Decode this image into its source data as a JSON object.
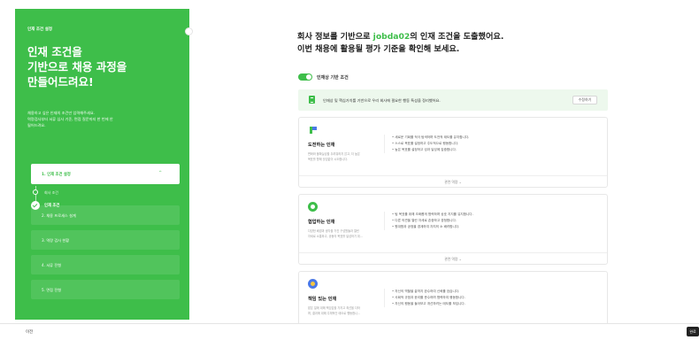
{
  "colors": {
    "accent": "#3ebe4a",
    "notice_bg": "#edf8ed",
    "dark_button": "#222222"
  },
  "sidebar": {
    "overline": "인재 조건 설정",
    "title_lines": [
      "인재 조건을",
      "기반으로 채용 과정을",
      "만들어드려요!"
    ],
    "desc_lines": [
      "채용하고 싶은 인재의 조건만 입력해주세요.",
      "역량검사부터 서류 심사 기준, 면접 질문까지 한 번에 안",
      "될어드려요."
    ],
    "active_step": {
      "label": "1. 인재 조건 설정",
      "chevron": "^"
    },
    "substeps": [
      "회사 조건",
      "인재 조건"
    ],
    "steps": [
      "2. 채용 프로세스 설계",
      "3. 역량 검사 현황",
      "4. 서류 전형",
      "5. 면접 전형"
    ]
  },
  "main": {
    "head_line1_prefix": "회사 정보를 기반으로 ",
    "head_company": "jobda02",
    "head_line1_suffix": "의 인재 조건을 도출했어요.",
    "head_line2": "이번 채용에 활용될 평가 기준을 확인해 보세요.",
    "toggle_label": "인재상 기반 조건",
    "toggle_on": true,
    "notice_text": "인재상 및 핵심가치를 기반으로 우리 회사에 필요한 행동 특성을 정리했어요.",
    "notice_button": "수정하기",
    "cards": [
      {
        "icon": "flag-icon",
        "name": "도전하는 인재",
        "desc_lines": [
          "변화와 불확실성을 두려워하지 않고, 더 높은",
          "목표를 향해 끊임없이 시도합니다."
        ],
        "bullets": [
          "새로운 기회를 적극 탐색하며 도전적 태도를 유지합니다.",
          "스스로 목표를 설정하고 주도적으로 행동합니다.",
          "높은 목표를 설정하고 성과 달성에 집중합니다."
        ],
        "more": "관련 역량 ⌄"
      },
      {
        "icon": "collaboration-icon",
        "name": "협업하는 인재",
        "desc_lines": [
          "다양한 배경과 생각을 가진 구성원들과 열린",
          "자세로 소통하고, 공동의 목표를 달성하기 위..."
        ],
        "bullets": [
          "팀 목표를 위해 조화롭게 협력하며 상호 지지를 유지합니다.",
          "다른 의견을 열린 자세로 존중하고 경청합니다.",
          "원대함과 공정을 경계하여 자치의 소 배려합니다."
        ],
        "more": "관련 역량 ⌄"
      },
      {
        "icon": "responsibility-icon",
        "name": "책임 있는 인재",
        "desc_lines": [
          "맡은 일에 대해 책임감을 가지고 최선을 다하",
          "며, 결과에 대해 주체적인 태도로 행동합니..."
        ],
        "bullets": [
          "자신의 역할을 끝까지 완수하여 신뢰를 얻습니다.",
          "사회적 규범과 윤리를 준수하며 협력하여 행동합니다.",
          "자신의 행동을 돌아보고 개선하려는 태도를 보입니다."
        ],
        "more": ""
      }
    ]
  },
  "footer": {
    "prev_label": "이전",
    "done_label": "완료"
  }
}
